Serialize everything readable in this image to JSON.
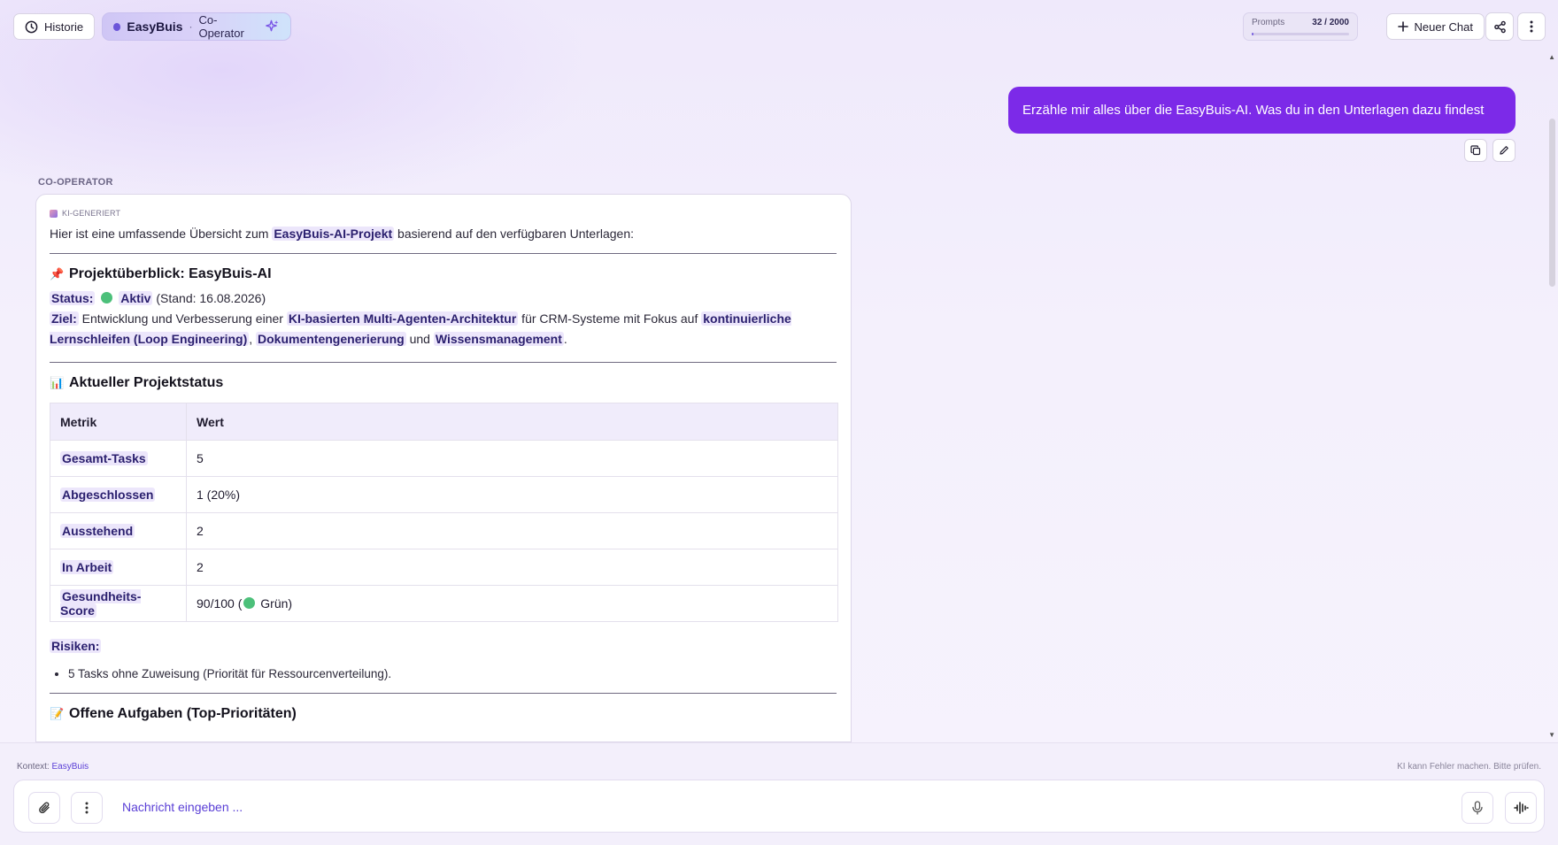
{
  "header": {
    "history_label": "Historie",
    "brand_name": "EasyBuis",
    "brand_separator": "·",
    "brand_sub": "Co-Operator",
    "prompts_label": "Prompts",
    "prompts_count": "32 / 2000",
    "prompts_used_fraction": 0.016,
    "new_chat_label": "Neuer Chat"
  },
  "user_message": "Erzähle mir alles über die EasyBuis-AI. Was du in den Unterlagen dazu findest",
  "assistant": {
    "role_label": "CO-OPERATOR",
    "tag": "KI-GENERIERT",
    "intro_pre": "Hier ist eine umfassende Übersicht zum ",
    "intro_highlight": "EasyBuis-AI-Projekt",
    "intro_post": " basierend auf den verfügbaren Unterlagen:",
    "section1_emoji": "📌",
    "section1_title": "Projektüberblick: EasyBuis-AI",
    "status_label": "Status:",
    "status_value": "Aktiv",
    "status_date": "(Stand: 16.08.2026)",
    "goal_label": "Ziel:",
    "goal_text1": " Entwicklung und Verbesserung einer ",
    "goal_hl1": "KI-basierten Multi-Agenten-Architektur",
    "goal_text2": " für CRM-Systeme mit Fokus auf ",
    "goal_hl2": "kontinuierliche Lernschleifen (Loop Engineering)",
    "goal_text3": ", ",
    "goal_hl3": "Dokumentengenerierung",
    "goal_text4": " und ",
    "goal_hl4": "Wissensmanagement",
    "goal_text5": ".",
    "section2_emoji": "📊",
    "section2_title": "Aktueller Projektstatus",
    "table_headers": [
      "Metrik",
      "Wert"
    ],
    "table_rows": [
      {
        "metric": "Gesamt-Tasks",
        "value": "5"
      },
      {
        "metric": "Abgeschlossen",
        "value": "1 (20%)"
      },
      {
        "metric": "Ausstehend",
        "value": "2"
      },
      {
        "metric": "In Arbeit",
        "value": "2"
      },
      {
        "metric": "Gesundheits-Score",
        "value_pre": "90/100 (",
        "value_post": " Grün)"
      }
    ],
    "risks_label": "Risiken:",
    "risks": [
      "5 Tasks ohne Zuweisung (Priorität für Ressourcenverteilung)."
    ],
    "section3_emoji": "📝",
    "section3_title": "Offene Aufgaben (Top-Prioritäten)"
  },
  "footer": {
    "context_label": "Kontext:",
    "context_value": "EasyBuis",
    "disclaimer": "KI kann Fehler machen. Bitte prüfen.",
    "input_placeholder": "Nachricht eingeben ..."
  },
  "colors": {
    "accent": "#7c2ae8",
    "brand": "#6b55d9",
    "status_green": "#4cc07a"
  },
  "icons": [
    "clock-icon",
    "sparkle-icon",
    "plus-icon",
    "share-icon",
    "more-vertical-icon",
    "copy-icon",
    "edit-icon",
    "paperclip-icon",
    "more-vertical-icon",
    "microphone-icon",
    "voice-wave-icon"
  ]
}
